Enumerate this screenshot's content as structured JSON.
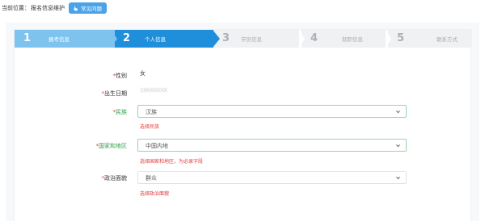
{
  "topbar": {
    "location_label": "当前位置：",
    "location_value": "报名信息维护",
    "faq_button": "常见问题"
  },
  "steps": [
    {
      "num": "1",
      "label": "报考信息",
      "state": "done"
    },
    {
      "num": "2",
      "label": "个人信息",
      "state": "active"
    },
    {
      "num": "3",
      "label": "学历信息",
      "state": "todo"
    },
    {
      "num": "4",
      "label": "就职信息",
      "state": "todo"
    },
    {
      "num": "5",
      "label": "联系方式",
      "state": "todo"
    }
  ],
  "form": {
    "gender": {
      "label": "性别",
      "value": "女"
    },
    "birthdate": {
      "label": "出生日期",
      "value": "19XXXXXX"
    },
    "ethnicity": {
      "label": "民族",
      "value": "汉族",
      "error": "选择民族"
    },
    "region": {
      "label": "国家和地区",
      "value": "中国内地",
      "error": "选择国家和地区，为必录字段"
    },
    "political": {
      "label": "政治面貌",
      "value": "群众",
      "error": "选择政治面貌"
    }
  },
  "colors": {
    "step_done": "#7ec3ee",
    "step_active": "#1f8fdc",
    "required": "#e23a3a",
    "valid_label": "#2e9e4a",
    "faq_button": "#4aa3e8"
  }
}
